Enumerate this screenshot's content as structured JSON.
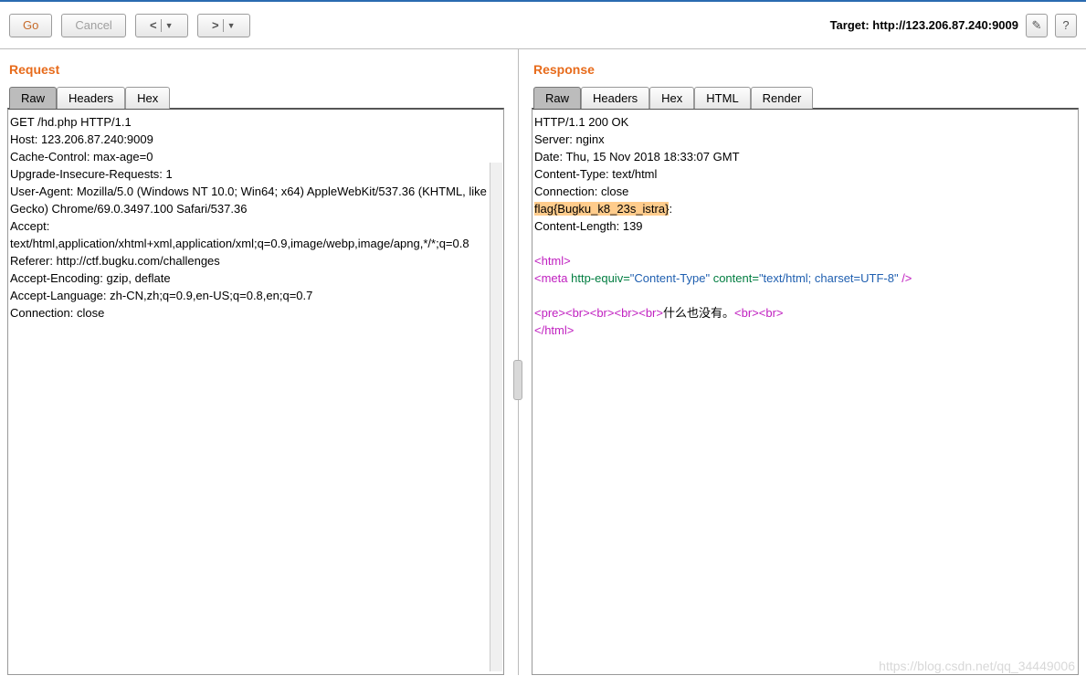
{
  "toolbar": {
    "go_label": "Go",
    "cancel_label": "Cancel",
    "target_prefix": "Target: ",
    "target_url": "http://123.206.87.240:9009"
  },
  "request": {
    "title": "Request",
    "tabs": {
      "raw": "Raw",
      "headers": "Headers",
      "hex": "Hex"
    },
    "lines": [
      "GET /hd.php HTTP/1.1",
      "Host: 123.206.87.240:9009",
      "Cache-Control: max-age=0",
      "Upgrade-Insecure-Requests: 1",
      "User-Agent: Mozilla/5.0 (Windows NT 10.0; Win64; x64) AppleWebKit/537.36 (KHTML, like Gecko) Chrome/69.0.3497.100 Safari/537.36",
      "Accept: text/html,application/xhtml+xml,application/xml;q=0.9,image/webp,image/apng,*/*;q=0.8",
      "Referer: http://ctf.bugku.com/challenges",
      "Accept-Encoding: gzip, deflate",
      "Accept-Language: zh-CN,zh;q=0.9,en-US;q=0.8,en;q=0.7",
      "Connection: close"
    ]
  },
  "response": {
    "title": "Response",
    "tabs": {
      "raw": "Raw",
      "headers": "Headers",
      "hex": "Hex",
      "html": "HTML",
      "render": "Render"
    },
    "header_lines": [
      "HTTP/1.1 200 OK",
      "Server: nginx",
      "Date: Thu, 15 Nov 2018 18:33:07 GMT",
      "Content-Type: text/html",
      "Connection: close"
    ],
    "flag_line": "flag{Bugku_k8_23s_istra}",
    "flag_suffix": ":",
    "content_length_line": "Content-Length: 139",
    "html_render": {
      "open_html": "<html>",
      "meta_open": "<meta ",
      "he_attr": "http-equiv=",
      "he_val": "\"Content-Type\"",
      "content_attr": " content=",
      "content_val": "\"text/html; charset=UTF-8\"",
      "meta_close": " />",
      "pre_open": "<pre>",
      "br": "<br>",
      "cn_text": "什么也没有。",
      "close_html": "</html>",
      "slash": "/"
    }
  },
  "watermark": "https://blog.csdn.net/qq_34449006"
}
